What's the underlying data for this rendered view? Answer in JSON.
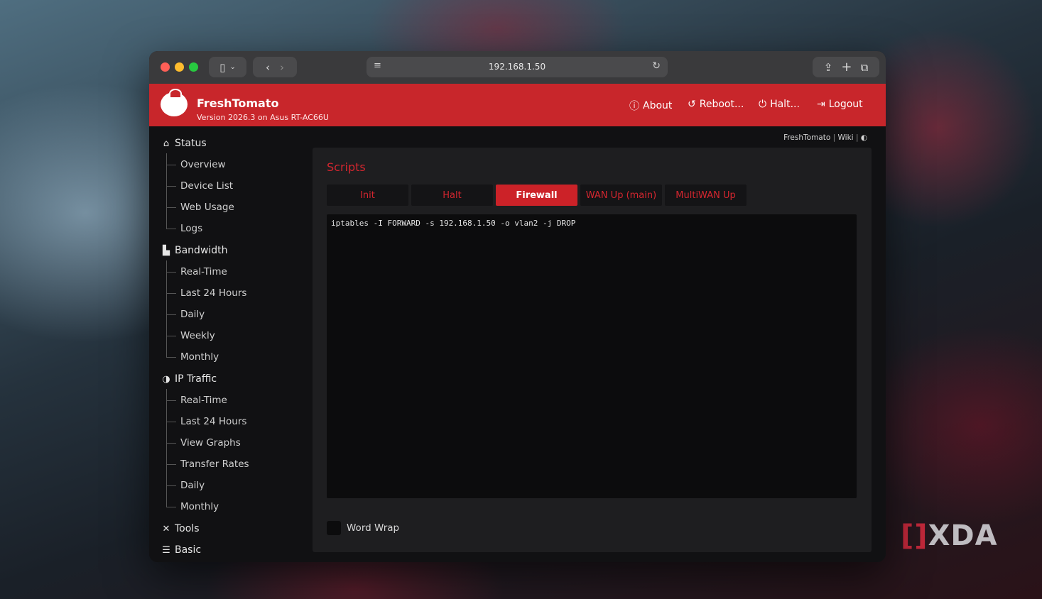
{
  "browser": {
    "url": "192.168.1.50"
  },
  "header": {
    "brand": "FreshTomato",
    "version": "Version 2026.3 on Asus RT-AC66U",
    "links": {
      "about": "About",
      "reboot": "Reboot...",
      "halt": "Halt...",
      "logout": "Logout"
    }
  },
  "topline": {
    "brand": "FreshTomato",
    "sep1": "|",
    "wiki": "Wiki",
    "sep2": "|"
  },
  "sidebar": {
    "status": {
      "label": "Status",
      "items": [
        "Overview",
        "Device List",
        "Web Usage",
        "Logs"
      ]
    },
    "bandwidth": {
      "label": "Bandwidth",
      "items": [
        "Real-Time",
        "Last 24 Hours",
        "Daily",
        "Weekly",
        "Monthly"
      ]
    },
    "ip_traffic": {
      "label": "IP Traffic",
      "items": [
        "Real-Time",
        "Last 24 Hours",
        "View Graphs",
        "Transfer Rates",
        "Daily",
        "Monthly"
      ]
    },
    "tools": {
      "label": "Tools"
    },
    "basic": {
      "label": "Basic"
    }
  },
  "panel": {
    "title": "Scripts",
    "tabs": [
      "Init",
      "Halt",
      "Firewall",
      "WAN Up (main)",
      "MultiWAN Up"
    ],
    "active_tab": "Firewall",
    "script": "iptables -I FORWARD -s 192.168.1.50 -o vlan2 -j DROP",
    "word_wrap_label": "Word Wrap"
  },
  "watermark": {
    "left": "[",
    "mid": "]",
    "text": "XDA"
  },
  "colors": {
    "accent": "#c8262b",
    "tab_active": "#cc2228",
    "tab_text": "#d3262f"
  }
}
